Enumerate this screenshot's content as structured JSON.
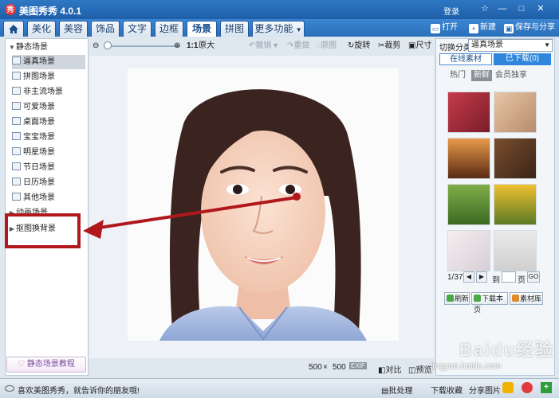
{
  "window": {
    "title": "美图秀秀 4.0.1",
    "login": "登录",
    "controls": [
      "☆",
      "—",
      "□",
      "✕"
    ]
  },
  "nav": {
    "tabs": [
      "美化",
      "美容",
      "饰品",
      "文字",
      "边框",
      "场景",
      "拼图",
      "更多功能"
    ],
    "active": "场景",
    "open": "打开",
    "new": "新建",
    "save_share": "保存与分享"
  },
  "left": {
    "static_scenes": "静态场景",
    "items": [
      "逼真场景",
      "拼图场景",
      "非主流场景",
      "可爱场景",
      "桌面场景",
      "宝宝场景",
      "明星场景",
      "节日场景",
      "日历场景",
      "其他场景"
    ],
    "dynamic_scenes": "动画场景",
    "cutout_bg": "抠图换背景",
    "tutorial": "静态场景教程"
  },
  "toolbar": {
    "original": "原大",
    "ratio": "1:1",
    "undo": "撤销",
    "redo": "重做",
    "reset": "原图",
    "rotate": "旋转",
    "crop": "裁剪",
    "size": "尺寸"
  },
  "canvas": {
    "size_w": "500",
    "size_sep": "×",
    "size_h": "500",
    "exif": "EXIF",
    "compare": "对比",
    "preview": "预览"
  },
  "right": {
    "switch_label": "切换分类",
    "category": "逼真场景",
    "tab_online": "在线素材",
    "tab_downloaded": "已下载(0)",
    "sub_hot": "热门",
    "sub_new": "新鲜",
    "sub_member": "会员独享",
    "page_current": "1/37",
    "page_to": "到",
    "page_unit": "页",
    "page_go": "GO",
    "refresh": "刷新",
    "download_page": "下载本页",
    "material_lib": "素材库"
  },
  "bottom": {
    "message": "喜欢美图秀秀，就告诉你的朋友哦!",
    "batch": "批处理",
    "download_fav": "下载收藏",
    "share_photo": "分享图片"
  },
  "watermark": {
    "brand": "Baidu经验",
    "url": "jingyan.baidu.com"
  },
  "colors": {
    "accent": "#2a6fb9",
    "annotation": "#b0181c"
  }
}
